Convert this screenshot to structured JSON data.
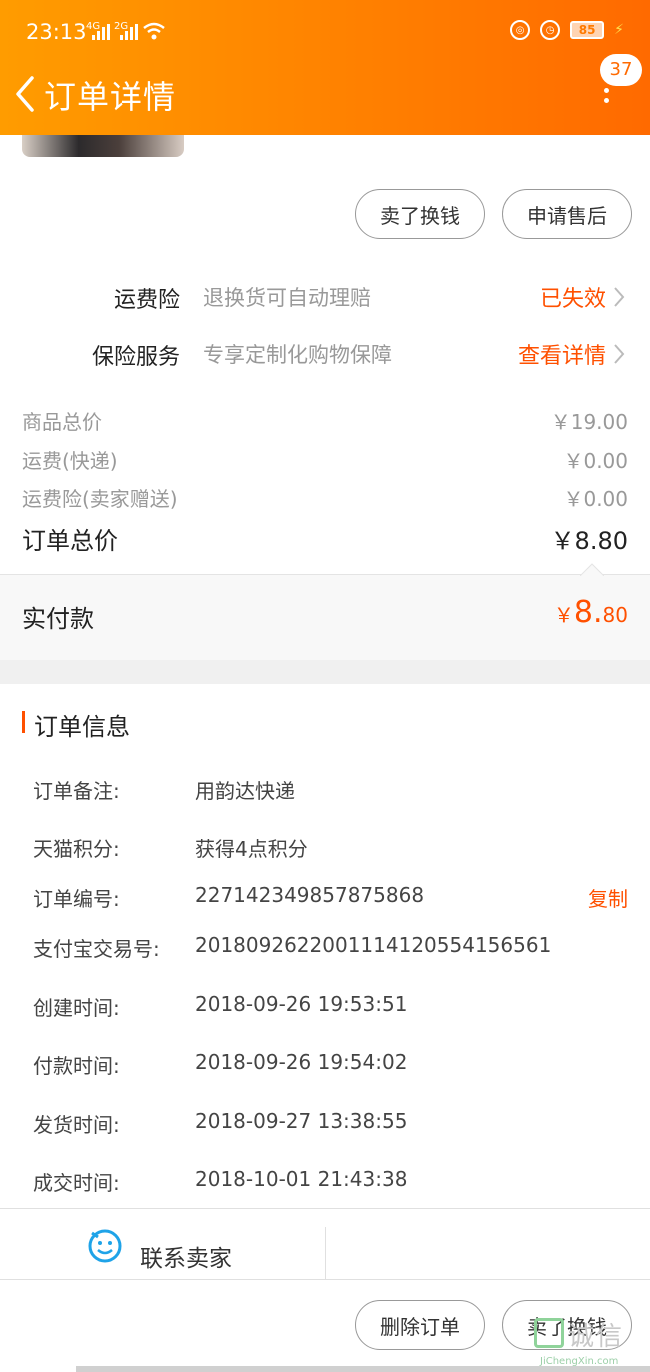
{
  "status": {
    "time": "23:13",
    "sig1": "4G",
    "sig2": "2G",
    "battery": "85"
  },
  "header": {
    "title": "订单详情",
    "badge": "37"
  },
  "top_actions": {
    "sell": "卖了换钱",
    "aftersale": "申请售后"
  },
  "insurance": [
    {
      "label": "运费险",
      "desc": "退换货可自动理赔",
      "action": "已失效"
    },
    {
      "label": "保险服务",
      "desc": "专享定制化购物保障",
      "action": "查看详情"
    }
  ],
  "prices": {
    "goods_label": "商品总价",
    "goods_value": "￥19.00",
    "shipping_label": "运费(快递)",
    "shipping_value": "￥0.00",
    "shipping_ins_label": "运费险(卖家赠送)",
    "shipping_ins_value": "￥0.00",
    "total_label": "订单总价",
    "total_value": "￥8.80"
  },
  "paid": {
    "label": "实付款",
    "currency": "￥",
    "int": "8.",
    "dec": "80"
  },
  "order_info": {
    "title": "订单信息",
    "rows": [
      {
        "k": "订单备注:",
        "v": "用韵达快递"
      },
      {
        "k": "天猫积分:",
        "v": "获得4点积分"
      },
      {
        "k": "订单编号:",
        "v": "227142349857875868"
      },
      {
        "k": "支付宝交易号:",
        "v": "2018092622001114120554156561"
      },
      {
        "k": "创建时间:",
        "v": "2018-09-26 19:53:51"
      },
      {
        "k": "付款时间:",
        "v": "2018-09-26 19:54:02"
      },
      {
        "k": "发货时间:",
        "v": "2018-09-27 13:38:55"
      },
      {
        "k": "成交时间:",
        "v": "2018-10-01 21:43:38"
      }
    ],
    "copy": "复制"
  },
  "contact": {
    "label": "联系卖家"
  },
  "bottom_actions": {
    "delete": "删除订单",
    "sell": "卖了换钱"
  },
  "watermark": {
    "text": "诚信",
    "sub": "JiChengXin.com"
  },
  "colors": {
    "accent": "#ff5000",
    "header_start": "#ff9c00",
    "header_end": "#ff6a00"
  }
}
